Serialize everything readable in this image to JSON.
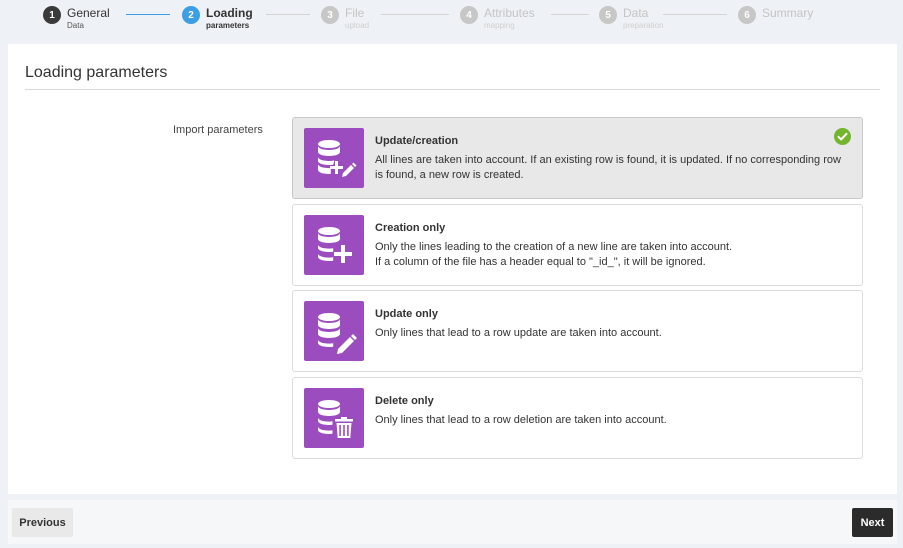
{
  "stepper": {
    "steps": [
      {
        "number": "1",
        "title": "General",
        "subtitle": "Data",
        "state": "done"
      },
      {
        "number": "2",
        "title": "Loading",
        "subtitle": "parameters",
        "state": "active"
      },
      {
        "number": "3",
        "title": "File",
        "subtitle": "upload",
        "state": "pending"
      },
      {
        "number": "4",
        "title": "Attributes",
        "subtitle": "mapping",
        "state": "pending"
      },
      {
        "number": "5",
        "title": "Data",
        "subtitle": "preparation",
        "state": "pending"
      },
      {
        "number": "6",
        "title": "Summary",
        "subtitle": "",
        "state": "pending"
      }
    ],
    "colors": {
      "done": "#3a3a3a",
      "active": "#3c9ee5",
      "pending": "#c7c7c7"
    }
  },
  "page": {
    "title": "Loading parameters",
    "field_label": "Import parameters"
  },
  "options": [
    {
      "title": "Update/creation",
      "description": "All lines are taken into account. If an existing row is found, it is updated. If no corresponding row is found, a new row is created.",
      "icon": "database-edit-plus-icon",
      "selected": true
    },
    {
      "title": "Creation only",
      "description": "Only the lines leading to the creation of a new line are taken into account.\nIf a column of the file has a header equal to \"_id_\", it will be ignored.",
      "icon": "database-plus-icon",
      "selected": false
    },
    {
      "title": "Update only",
      "description": "Only lines that lead to a row update are taken into account.",
      "icon": "database-edit-icon",
      "selected": false
    },
    {
      "title": "Delete only",
      "description": "Only lines that lead to a row deletion are taken into account.",
      "icon": "database-trash-icon",
      "selected": false
    }
  ],
  "colors": {
    "accent": "#9b4dbf",
    "check": "#73b52e",
    "primary_button": "#2b2b2b"
  },
  "footer": {
    "previous_label": "Previous",
    "next_label": "Next"
  }
}
